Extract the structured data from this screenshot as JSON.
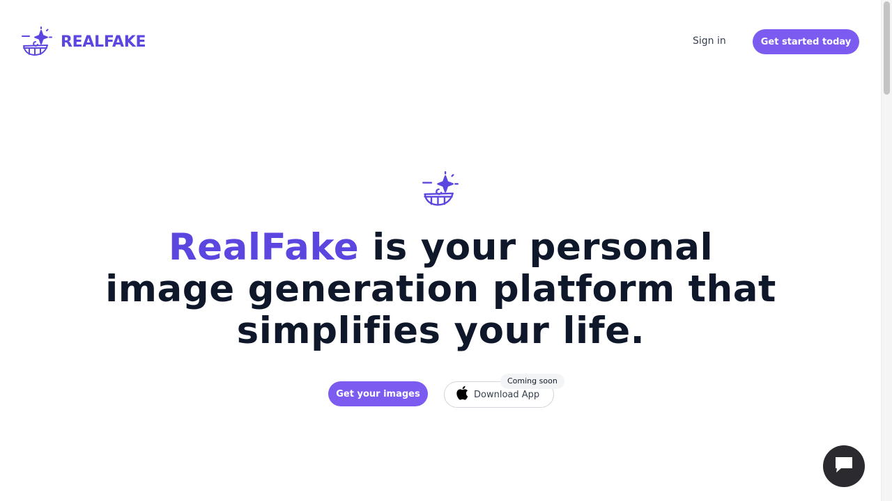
{
  "header": {
    "brand_name": "REALFAKE",
    "signin_label": "Sign in",
    "get_started_label": "Get started today"
  },
  "hero": {
    "title_brand": "RealFake",
    "title_rest": "is your personal image generation platform that simplifies your life.",
    "get_images_label": "Get your images",
    "download_label": "Download App",
    "coming_soon_label": "Coming soon"
  },
  "icons": {
    "logo": "sparkle-smile-logo-icon",
    "apple": "apple-icon",
    "chat": "chat-icon"
  },
  "colors": {
    "brand": "#5b47e0",
    "button": "#7c5cf0",
    "heading": "#0f172a",
    "chat_bg": "#2b2a2e"
  }
}
